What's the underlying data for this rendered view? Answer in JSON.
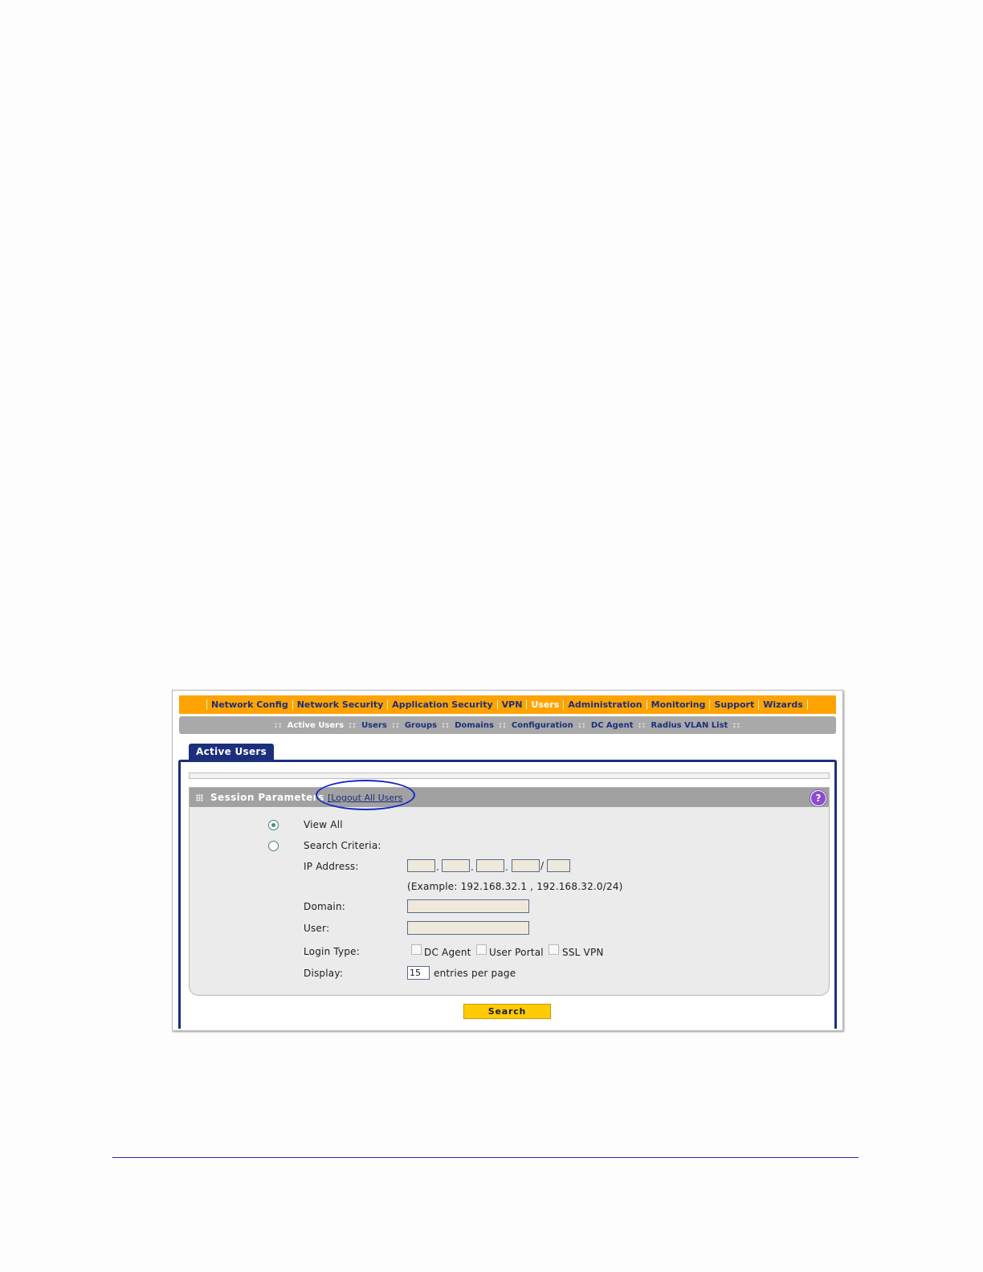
{
  "top_nav": {
    "items": [
      "Network Config",
      "Network Security",
      "Application Security",
      "VPN",
      "Users",
      "Administration",
      "Monitoring",
      "Support",
      "Wizards"
    ],
    "active": "Users"
  },
  "sub_nav": {
    "items": [
      "Active Users",
      "Users",
      "Groups",
      "Domains",
      "Configuration",
      "DC Agent",
      "Radius VLAN List"
    ],
    "separator": "::",
    "active": "Active Users"
  },
  "tab": {
    "label": "Active Users"
  },
  "section": {
    "title": "Session Parameters",
    "logout_link": "[Logout All Users",
    "help_icon": "?"
  },
  "form": {
    "view_all_label": "View All",
    "search_criteria_label": "Search Criteria:",
    "selected_option": "View All",
    "ip_label": "IP Address:",
    "ip_sep_dot": ".",
    "ip_sep_slash": "/",
    "ip_example": "(Example: 192.168.32.1 , 192.168.32.0/24)",
    "domain_label": "Domain:",
    "user_label": "User:",
    "login_type_label": "Login Type:",
    "login_types": [
      "DC Agent",
      "User Portal",
      "SSL VPN"
    ],
    "display_label": "Display:",
    "display_value": "15",
    "entries_suffix": "entries per page"
  },
  "search_button": "Search",
  "colors": {
    "nav_orange": "#ffa303",
    "nav_text": "#1c2f7c",
    "subnav_gray": "#a9a9a9",
    "tab_navy": "#1c2f7c",
    "button_yellow": "#ffcb07",
    "highlight_ellipse": "#1727c8"
  }
}
